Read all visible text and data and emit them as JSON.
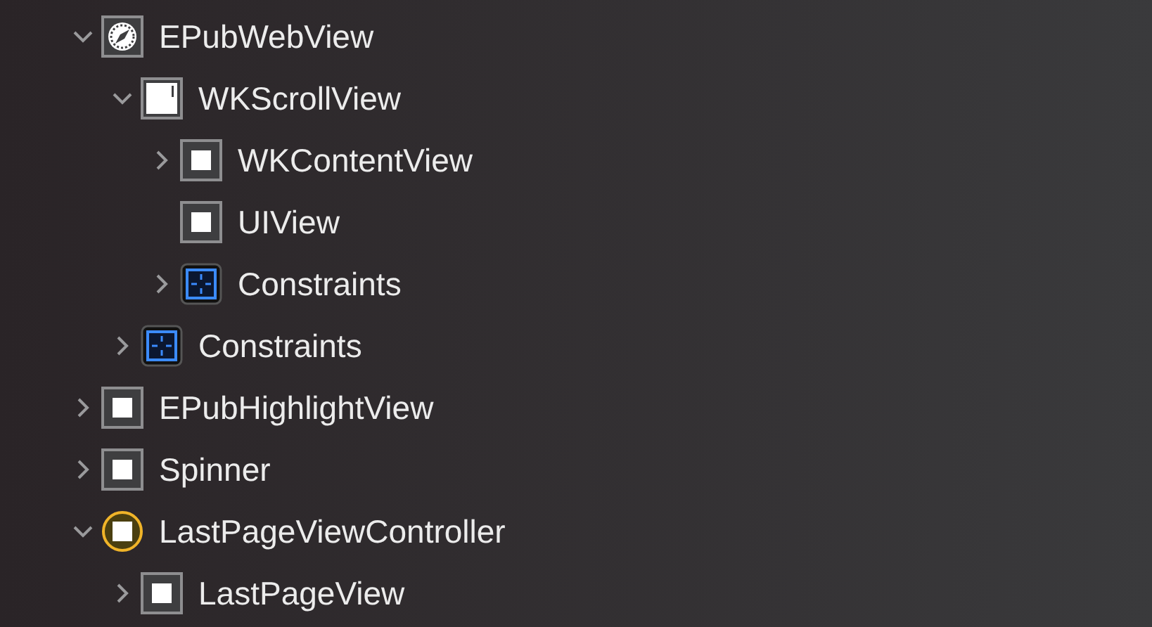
{
  "tree": [
    {
      "label": "EPubWebView",
      "kind": "web",
      "expanded": true,
      "children": [
        {
          "label": "WKScrollView",
          "kind": "scroll",
          "expanded": true,
          "children": [
            {
              "label": "WKContentView",
              "kind": "view",
              "expanded": false
            },
            {
              "label": "UIView",
              "kind": "view"
            },
            {
              "label": "Constraints",
              "kind": "constraints",
              "expanded": false
            }
          ]
        },
        {
          "label": "Constraints",
          "kind": "constraints",
          "expanded": false
        }
      ]
    },
    {
      "label": "EPubHighlightView",
      "kind": "view",
      "expanded": false
    },
    {
      "label": "Spinner",
      "kind": "view",
      "expanded": false
    },
    {
      "label": "LastPageViewController",
      "kind": "controller",
      "expanded": true,
      "children": [
        {
          "label": "LastPageView",
          "kind": "view",
          "expanded": false
        }
      ]
    }
  ]
}
